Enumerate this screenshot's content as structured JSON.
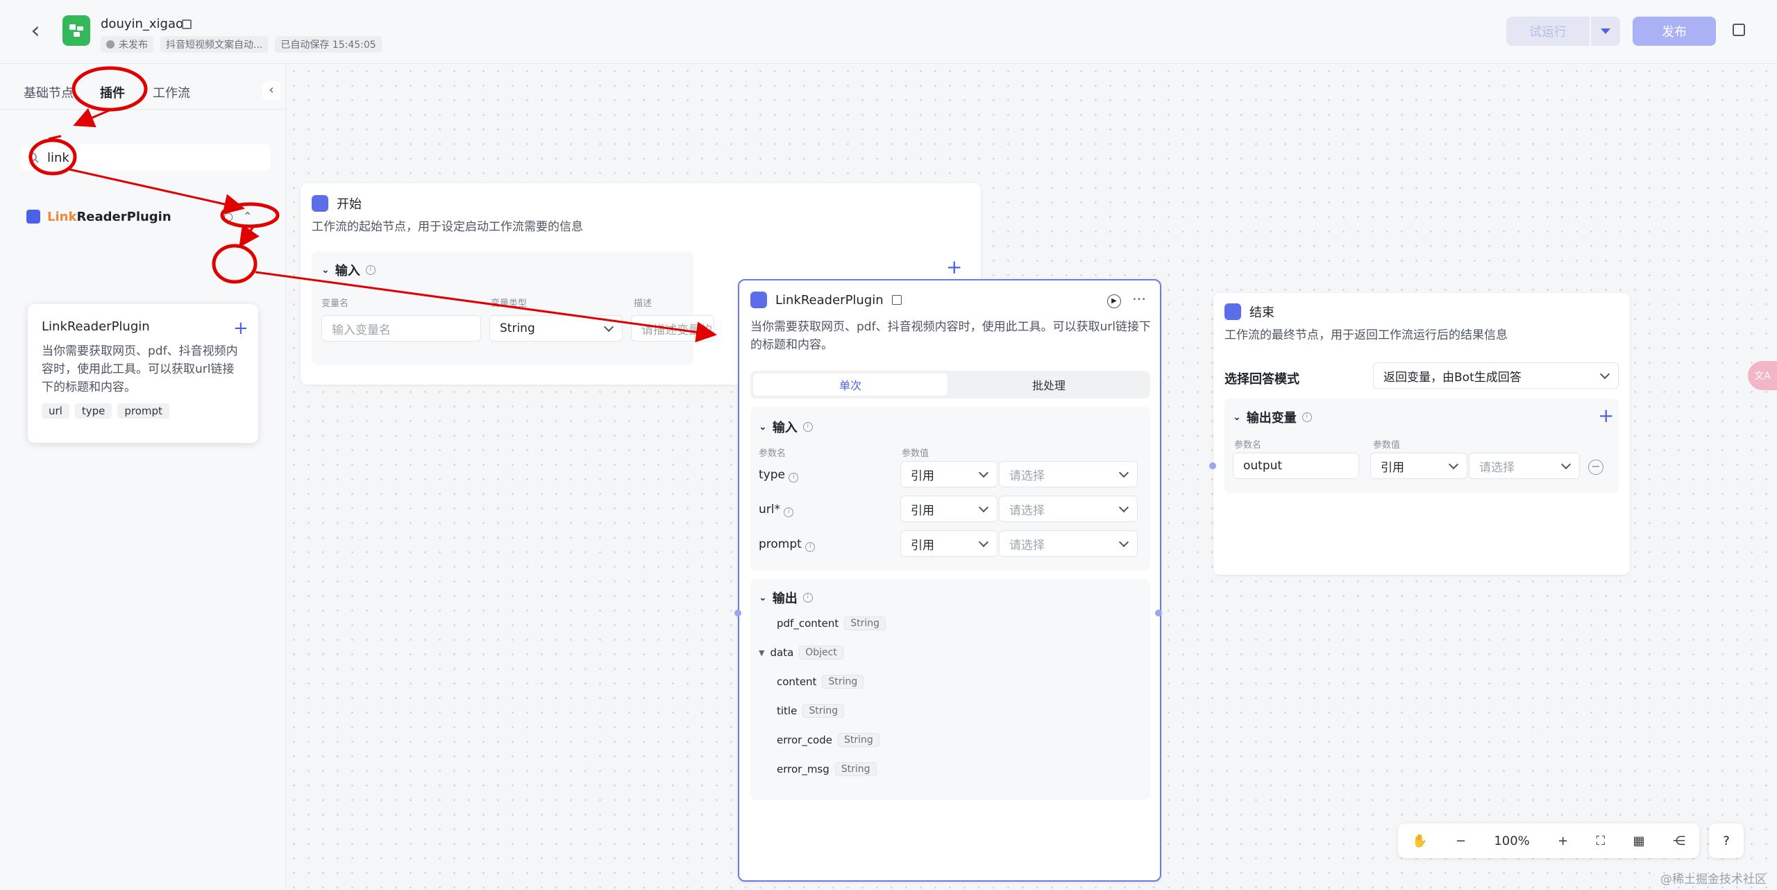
{
  "header": {
    "app_name": "douyin_xigao",
    "status": "未发布",
    "description": "抖音短视频文案自动...",
    "autosave": "已自动保存 15:45:05",
    "test_run": "试运行",
    "publish": "发布"
  },
  "sidebar": {
    "tabs": [
      "基础节点",
      "插件",
      "工作流"
    ],
    "search_value": "link",
    "plugin": {
      "name_highlight": "Link",
      "name_rest": "ReaderPlugin"
    },
    "tool": {
      "name": "LinkReaderPlugin",
      "description": "当你需要获取网页、pdf、抖音视频内容时，使用此工具。可以获取url链接下的标题和内容。",
      "params": [
        "url",
        "type",
        "prompt"
      ]
    }
  },
  "start_node": {
    "title": "开始",
    "description": "工作流的起始节点，用于设定启动工作流需要的信息",
    "input_title": "输入",
    "col_name": "变量名",
    "col_type": "变量类型",
    "col_desc": "描述",
    "name_placeholder": "输入变量名",
    "type_value": "String",
    "desc_placeholder": "请描述变量的用途"
  },
  "plugin_node": {
    "title": "LinkReaderPlugin",
    "description": "当你需要获取网页、pdf、抖音视频内容时，使用此工具。可以获取url链接下的标题和内容。",
    "mode_single": "单次",
    "mode_batch": "批处理",
    "input_title": "输入",
    "col_param": "参数名",
    "col_value": "参数值",
    "inputs": [
      {
        "name": "type",
        "source": "引用",
        "value": "请选择"
      },
      {
        "name": "url*",
        "source": "引用",
        "value": "请选择"
      },
      {
        "name": "prompt",
        "source": "引用",
        "value": "请选择"
      }
    ],
    "output_title": "输出",
    "outputs": [
      {
        "name": "pdf_content",
        "type": "String"
      },
      {
        "name": "data",
        "type": "Object"
      },
      {
        "name": "content",
        "type": "String"
      },
      {
        "name": "title",
        "type": "String"
      },
      {
        "name": "error_code",
        "type": "String"
      },
      {
        "name": "error_msg",
        "type": "String"
      }
    ]
  },
  "end_node": {
    "title": "结束",
    "description": "工作流的最终节点，用于返回工作流运行后的结果信息",
    "mode_label": "选择回答模式",
    "mode_value": "返回变量，由Bot生成回答",
    "output_title": "输出变量",
    "col_param": "参数名",
    "col_value": "参数值",
    "var_name": "output",
    "var_source": "引用",
    "var_value": "请选择"
  },
  "zoom": {
    "level": "100%"
  },
  "side_float": "文A",
  "watermark": "@稀土掘金技术社区",
  "colors": {
    "accent": "#4c62e6",
    "annotation": "#e00000",
    "brand_green": "#35b85a"
  }
}
